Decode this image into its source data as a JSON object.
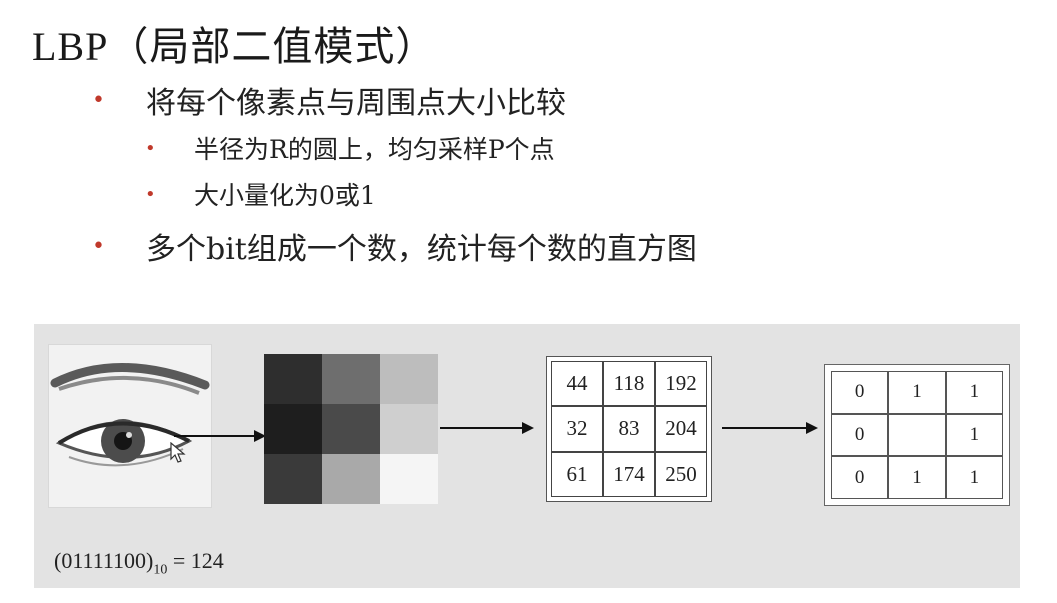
{
  "title": "LBP（局部二值模式）",
  "bullets": [
    {
      "level": 1,
      "text": "将每个像素点与周围点大小比较"
    },
    {
      "level": 2,
      "text": "半径为R的圆上，均匀采样P个点"
    },
    {
      "level": 2,
      "text": "大小量化为0或1"
    },
    {
      "level": 1,
      "text": "多个bit组成一个数，统计每个数的直方图"
    }
  ],
  "bullet_color": "#c0392b",
  "figure": {
    "gray_patch": [
      "#2e2e2e",
      "#6e6e6e",
      "#bdbdbd",
      "#1e1e1e",
      "#4a4a4a",
      "#cfcfcf",
      "#3a3a3a",
      "#a9a9a9",
      "#f5f5f5"
    ],
    "pixel_values": [
      "44",
      "118",
      "192",
      "32",
      "83",
      "204",
      "61",
      "174",
      "250"
    ],
    "binary_values": [
      "0",
      "1",
      "1",
      "0",
      "",
      "1",
      "0",
      "1",
      "1"
    ],
    "formula": {
      "binary": "(01111100)",
      "base": "10",
      "equals": "= 124"
    }
  }
}
